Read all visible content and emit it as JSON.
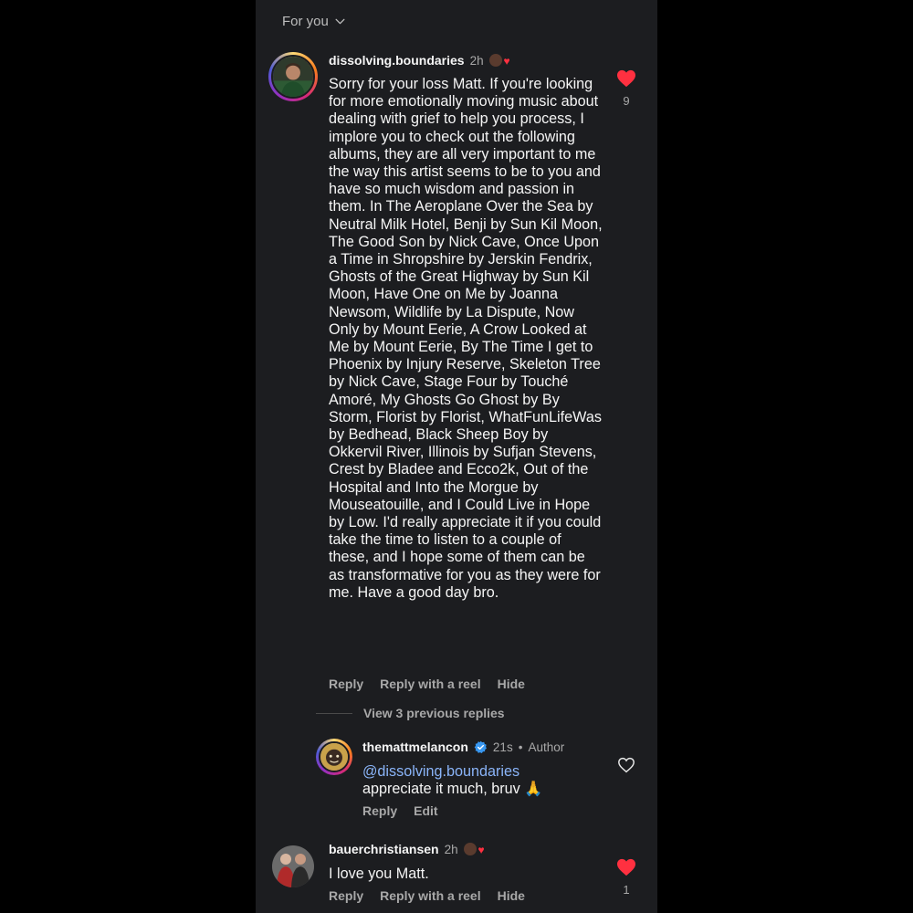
{
  "header": {
    "label": "For you"
  },
  "comments": [
    {
      "username": "dissolving.boundaries",
      "time": "2h",
      "text": "Sorry for your loss Matt. If you're looking for more emotionally moving music about dealing with grief to help you process, I implore you to check out the following albums, they are all very important to me the way this artist seems to be to you and have so much wisdom and passion in them. In The Aeroplane Over the Sea by Neutral Milk Hotel, Benji by Sun Kil Moon, The Good Son by Nick Cave, Once Upon a Time in Shropshire by Jerskin Fendrix, Ghosts of the Great Highway by Sun Kil Moon, Have One on Me by Joanna Newsom, Wildlife by La Dispute, Now Only by Mount Eerie, A Crow Looked at Me by Mount Eerie, By The Time I get to Phoenix by Injury Reserve, Skeleton Tree by Nick Cave, Stage Four by Touché Amoré, My Ghosts Go Ghost by By Storm, Florist by Florist, WhatFunLifeWas by Bedhead, Black Sheep Boy by Okkervil River, Illinois by Sufjan Stevens, Crest by Bladee and Ecco2k, Out of the Hospital and Into the Morgue by Mouseatouille, and I Could Live in Hope by Low. I'd really appreciate it if you could take the time to listen to a couple of these, and I hope some of them can be as transformative for you as they were for me. Have a good day bro.",
      "likes": "9",
      "actions": {
        "reply": "Reply",
        "reply_reel": "Reply with a reel",
        "hide": "Hide"
      },
      "view_replies": "View 3 previous replies"
    },
    {
      "username": "bauerchristiansen",
      "time": "2h",
      "text": "I love you Matt.",
      "likes": "1",
      "actions": {
        "reply": "Reply",
        "reply_reel": "Reply with a reel",
        "hide": "Hide"
      }
    }
  ],
  "reply": {
    "username": "themattmelancon",
    "time": "21s",
    "separator": "•",
    "role": "Author",
    "mention": "@dissolving.boundaries",
    "text": "appreciate it much, bruv 🙏",
    "actions": {
      "reply": "Reply",
      "edit": "Edit"
    }
  },
  "colors": {
    "heart": "#ff3040",
    "mention": "#8ab4f8",
    "verified": "#3897f0",
    "panel_bg": "#1c1d20"
  },
  "icons": {
    "heart_filled": "heart-icon",
    "heart_outline": "heart-outline-icon",
    "verified": "verified-badge-icon",
    "chevron": "chevron-down-icon"
  }
}
